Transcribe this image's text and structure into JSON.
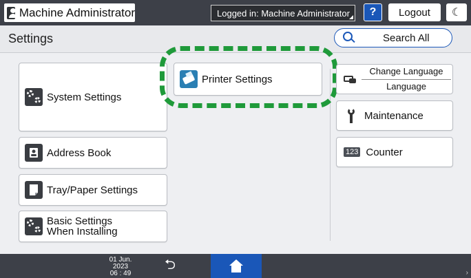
{
  "topbar": {
    "user_label": "Machine Administrator",
    "status": "Logged in: Machine Administrator",
    "help_label": "?",
    "logout_label": "Logout",
    "energy_icon": "crescent-moon"
  },
  "titlebar": {
    "title": "Settings",
    "search_label": "Search All"
  },
  "left_items": [
    {
      "label": "System Settings",
      "icon": "gears-icon"
    },
    {
      "label": "Address Book",
      "icon": "address-book-icon"
    },
    {
      "label": "Tray/Paper Settings",
      "icon": "paper-icon"
    },
    {
      "label_line1": "Basic Settings",
      "label_line2": "When Installing",
      "icon": "gears-icon"
    }
  ],
  "center_items": [
    {
      "label": "Printer Settings",
      "icon": "printer-icon"
    }
  ],
  "right_items": {
    "language_top": "Change Language",
    "language_bottom": "Language",
    "maintenance": "Maintenance",
    "counter_icon": "123",
    "counter": "Counter"
  },
  "bottombar": {
    "date": "01 Jun. 2023",
    "time": "06 : 49"
  },
  "colors": {
    "highlight": "#1f9a3a",
    "accent": "#1a57b8",
    "bar": "#3d4048"
  }
}
